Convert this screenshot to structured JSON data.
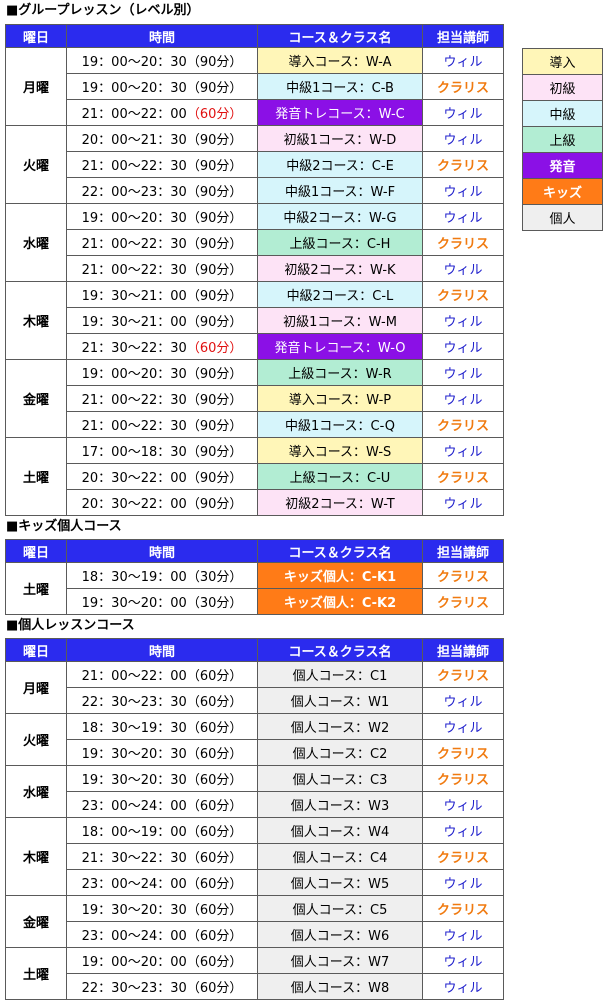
{
  "sections": {
    "group_title": "■グループレッスン（レベル別）",
    "kids_title": "■キッズ個人コース",
    "personal_title": "■個人レッスンコース"
  },
  "headers": {
    "day": "曜日",
    "time": "時間",
    "course": "コース＆クラス名",
    "teacher": "担当講師"
  },
  "legend": [
    {
      "label": "導入",
      "level": "intro"
    },
    {
      "label": "初級",
      "level": "beg"
    },
    {
      "label": "中級",
      "level": "mid"
    },
    {
      "label": "上級",
      "level": "adv"
    },
    {
      "label": "発音",
      "level": "pron"
    },
    {
      "label": "キッズ",
      "level": "kids"
    },
    {
      "label": "個人",
      "level": "pers"
    }
  ],
  "group_lessons": [
    {
      "day": "月曜",
      "rows": [
        {
          "time": "19：00～20：30",
          "dur": "（90分）",
          "dur_red": false,
          "course": "導入コース：W-A",
          "level": "intro",
          "teacher": "ウィル"
        },
        {
          "time": "19：00～20：30",
          "dur": "（90分）",
          "dur_red": false,
          "course": "中級1コース：C-B",
          "level": "mid",
          "teacher": "クラリス"
        },
        {
          "time": "21：00～22：00",
          "dur": "（60分）",
          "dur_red": true,
          "course": "発音トレコース：W-C",
          "level": "pron",
          "teacher": "ウィル"
        }
      ]
    },
    {
      "day": "火曜",
      "rows": [
        {
          "time": "20：00～21：30",
          "dur": "（90分）",
          "dur_red": false,
          "course": "初級1コース：W-D",
          "level": "beg",
          "teacher": "ウィル"
        },
        {
          "time": "21：00～22：30",
          "dur": "（90分）",
          "dur_red": false,
          "course": "中級2コース：C-E",
          "level": "mid",
          "teacher": "クラリス"
        },
        {
          "time": "22：00～23：30",
          "dur": "（90分）",
          "dur_red": false,
          "course": "中級1コース：W-F",
          "level": "mid",
          "teacher": "ウィル"
        }
      ]
    },
    {
      "day": "水曜",
      "rows": [
        {
          "time": "19：00～20：30",
          "dur": "（90分）",
          "dur_red": false,
          "course": "中級2コース：W-G",
          "level": "mid",
          "teacher": "ウィル"
        },
        {
          "time": "21：00～22：30",
          "dur": "（90分）",
          "dur_red": false,
          "course": "上級コース：C-H",
          "level": "adv",
          "teacher": "クラリス"
        },
        {
          "time": "21：00～22：30",
          "dur": "（90分）",
          "dur_red": false,
          "course": "初級2コース：W-K",
          "level": "beg",
          "teacher": "ウィル"
        }
      ]
    },
    {
      "day": "木曜",
      "rows": [
        {
          "time": "19：30～21：00",
          "dur": "（90分）",
          "dur_red": false,
          "course": "中級2コース：C-L",
          "level": "mid",
          "teacher": "クラリス"
        },
        {
          "time": "19：30～21：00",
          "dur": "（90分）",
          "dur_red": false,
          "course": "初級1コース：W-M",
          "level": "beg",
          "teacher": "ウィル"
        },
        {
          "time": "21：30～22：30",
          "dur": "（60分）",
          "dur_red": true,
          "course": "発音トレコース：W-O",
          "level": "pron",
          "teacher": "ウィル"
        }
      ]
    },
    {
      "day": "金曜",
      "rows": [
        {
          "time": "19：00～20：30",
          "dur": "（90分）",
          "dur_red": false,
          "course": "上級コース：W-R",
          "level": "adv",
          "teacher": "ウィル"
        },
        {
          "time": "21：00～22：30",
          "dur": "（90分）",
          "dur_red": false,
          "course": "導入コース：W-P",
          "level": "intro",
          "teacher": "ウィル"
        },
        {
          "time": "21：00～22：30",
          "dur": "（90分）",
          "dur_red": false,
          "course": "中級1コース：C-Q",
          "level": "mid",
          "teacher": "クラリス"
        }
      ]
    },
    {
      "day": "土曜",
      "rows": [
        {
          "time": "17：00～18：30",
          "dur": "（90分）",
          "dur_red": false,
          "course": "導入コース：W-S",
          "level": "intro",
          "teacher": "ウィル"
        },
        {
          "time": "20：30～22：00",
          "dur": "（90分）",
          "dur_red": false,
          "course": "上級コース：C-U",
          "level": "adv",
          "teacher": "クラリス"
        },
        {
          "time": "20：30～22：00",
          "dur": "（90分）",
          "dur_red": false,
          "course": "初級2コース：W-T",
          "level": "beg",
          "teacher": "ウィル"
        }
      ]
    }
  ],
  "kids_lessons": [
    {
      "day": "土曜",
      "rows": [
        {
          "time": "18：30～19：00",
          "dur": "（30分）",
          "dur_red": false,
          "course": "キッズ個人：C-K1",
          "level": "kids",
          "teacher": "クラリス"
        },
        {
          "time": "19：30～20：00",
          "dur": "（30分）",
          "dur_red": false,
          "course": "キッズ個人：C-K2",
          "level": "kids",
          "teacher": "クラリス"
        }
      ]
    }
  ],
  "personal_lessons": [
    {
      "day": "月曜",
      "rows": [
        {
          "time": "21：00～22：00",
          "dur": "（60分）",
          "dur_red": false,
          "course": "個人コース：C1",
          "level": "pers",
          "teacher": "クラリス"
        },
        {
          "time": "22：30～23：30",
          "dur": "（60分）",
          "dur_red": false,
          "course": "個人コース：W1",
          "level": "pers",
          "teacher": "ウィル"
        }
      ]
    },
    {
      "day": "火曜",
      "rows": [
        {
          "time": "18：30～19：30",
          "dur": "（60分）",
          "dur_red": false,
          "course": "個人コース：W2",
          "level": "pers",
          "teacher": "ウィル"
        },
        {
          "time": "19：30～20：30",
          "dur": "（60分）",
          "dur_red": false,
          "course": "個人コース：C2",
          "level": "pers",
          "teacher": "クラリス"
        }
      ]
    },
    {
      "day": "水曜",
      "rows": [
        {
          "time": "19：30～20：30",
          "dur": "（60分）",
          "dur_red": false,
          "course": "個人コース：C3",
          "level": "pers",
          "teacher": "クラリス"
        },
        {
          "time": "23：00～24：00",
          "dur": "（60分）",
          "dur_red": false,
          "course": "個人コース：W3",
          "level": "pers",
          "teacher": "ウィル"
        }
      ]
    },
    {
      "day": "木曜",
      "rows": [
        {
          "time": "18：00～19：00",
          "dur": "（60分）",
          "dur_red": false,
          "course": "個人コース：W4",
          "level": "pers",
          "teacher": "ウィル"
        },
        {
          "time": "21：30～22：30",
          "dur": "（60分）",
          "dur_red": false,
          "course": "個人コース：C4",
          "level": "pers",
          "teacher": "クラリス"
        },
        {
          "time": "23：00～24：00",
          "dur": "（60分）",
          "dur_red": false,
          "course": "個人コース：W5",
          "level": "pers",
          "teacher": "ウィル"
        }
      ]
    },
    {
      "day": "金曜",
      "rows": [
        {
          "time": "19：30～20：30",
          "dur": "（60分）",
          "dur_red": false,
          "course": "個人コース：C5",
          "level": "pers",
          "teacher": "クラリス"
        },
        {
          "time": "23：00～24：00",
          "dur": "（60分）",
          "dur_red": false,
          "course": "個人コース：W6",
          "level": "pers",
          "teacher": "ウィル"
        }
      ]
    },
    {
      "day": "土曜",
      "rows": [
        {
          "time": "19：00～20：00",
          "dur": "（60分）",
          "dur_red": false,
          "course": "個人コース：W7",
          "level": "pers",
          "teacher": "ウィル"
        },
        {
          "time": "22：30～23：30",
          "dur": "（60分）",
          "dur_red": false,
          "course": "個人コース：W8",
          "level": "pers",
          "teacher": "ウィル"
        }
      ]
    }
  ],
  "teacher_clarice": "クラリス"
}
